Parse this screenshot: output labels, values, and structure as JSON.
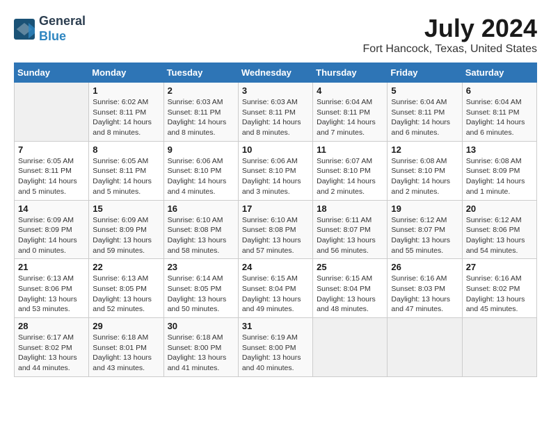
{
  "header": {
    "logo_line1": "General",
    "logo_line2": "Blue",
    "title": "July 2024",
    "subtitle": "Fort Hancock, Texas, United States"
  },
  "calendar": {
    "weekdays": [
      "Sunday",
      "Monday",
      "Tuesday",
      "Wednesday",
      "Thursday",
      "Friday",
      "Saturday"
    ],
    "weeks": [
      [
        {
          "day": "",
          "empty": true
        },
        {
          "day": "1",
          "sunrise": "6:02 AM",
          "sunset": "8:11 PM",
          "daylight": "14 hours and 8 minutes."
        },
        {
          "day": "2",
          "sunrise": "6:03 AM",
          "sunset": "8:11 PM",
          "daylight": "14 hours and 8 minutes."
        },
        {
          "day": "3",
          "sunrise": "6:03 AM",
          "sunset": "8:11 PM",
          "daylight": "14 hours and 8 minutes."
        },
        {
          "day": "4",
          "sunrise": "6:04 AM",
          "sunset": "8:11 PM",
          "daylight": "14 hours and 7 minutes."
        },
        {
          "day": "5",
          "sunrise": "6:04 AM",
          "sunset": "8:11 PM",
          "daylight": "14 hours and 6 minutes."
        },
        {
          "day": "6",
          "sunrise": "6:04 AM",
          "sunset": "8:11 PM",
          "daylight": "14 hours and 6 minutes."
        }
      ],
      [
        {
          "day": "7",
          "sunrise": "6:05 AM",
          "sunset": "8:11 PM",
          "daylight": "14 hours and 5 minutes."
        },
        {
          "day": "8",
          "sunrise": "6:05 AM",
          "sunset": "8:11 PM",
          "daylight": "14 hours and 5 minutes."
        },
        {
          "day": "9",
          "sunrise": "6:06 AM",
          "sunset": "8:10 PM",
          "daylight": "14 hours and 4 minutes."
        },
        {
          "day": "10",
          "sunrise": "6:06 AM",
          "sunset": "8:10 PM",
          "daylight": "14 hours and 3 minutes."
        },
        {
          "day": "11",
          "sunrise": "6:07 AM",
          "sunset": "8:10 PM",
          "daylight": "14 hours and 2 minutes."
        },
        {
          "day": "12",
          "sunrise": "6:08 AM",
          "sunset": "8:10 PM",
          "daylight": "14 hours and 2 minutes."
        },
        {
          "day": "13",
          "sunrise": "6:08 AM",
          "sunset": "8:09 PM",
          "daylight": "14 hours and 1 minute."
        }
      ],
      [
        {
          "day": "14",
          "sunrise": "6:09 AM",
          "sunset": "8:09 PM",
          "daylight": "14 hours and 0 minutes."
        },
        {
          "day": "15",
          "sunrise": "6:09 AM",
          "sunset": "8:09 PM",
          "daylight": "13 hours and 59 minutes."
        },
        {
          "day": "16",
          "sunrise": "6:10 AM",
          "sunset": "8:08 PM",
          "daylight": "13 hours and 58 minutes."
        },
        {
          "day": "17",
          "sunrise": "6:10 AM",
          "sunset": "8:08 PM",
          "daylight": "13 hours and 57 minutes."
        },
        {
          "day": "18",
          "sunrise": "6:11 AM",
          "sunset": "8:07 PM",
          "daylight": "13 hours and 56 minutes."
        },
        {
          "day": "19",
          "sunrise": "6:12 AM",
          "sunset": "8:07 PM",
          "daylight": "13 hours and 55 minutes."
        },
        {
          "day": "20",
          "sunrise": "6:12 AM",
          "sunset": "8:06 PM",
          "daylight": "13 hours and 54 minutes."
        }
      ],
      [
        {
          "day": "21",
          "sunrise": "6:13 AM",
          "sunset": "8:06 PM",
          "daylight": "13 hours and 53 minutes."
        },
        {
          "day": "22",
          "sunrise": "6:13 AM",
          "sunset": "8:05 PM",
          "daylight": "13 hours and 52 minutes."
        },
        {
          "day": "23",
          "sunrise": "6:14 AM",
          "sunset": "8:05 PM",
          "daylight": "13 hours and 50 minutes."
        },
        {
          "day": "24",
          "sunrise": "6:15 AM",
          "sunset": "8:04 PM",
          "daylight": "13 hours and 49 minutes."
        },
        {
          "day": "25",
          "sunrise": "6:15 AM",
          "sunset": "8:04 PM",
          "daylight": "13 hours and 48 minutes."
        },
        {
          "day": "26",
          "sunrise": "6:16 AM",
          "sunset": "8:03 PM",
          "daylight": "13 hours and 47 minutes."
        },
        {
          "day": "27",
          "sunrise": "6:16 AM",
          "sunset": "8:02 PM",
          "daylight": "13 hours and 45 minutes."
        }
      ],
      [
        {
          "day": "28",
          "sunrise": "6:17 AM",
          "sunset": "8:02 PM",
          "daylight": "13 hours and 44 minutes."
        },
        {
          "day": "29",
          "sunrise": "6:18 AM",
          "sunset": "8:01 PM",
          "daylight": "13 hours and 43 minutes."
        },
        {
          "day": "30",
          "sunrise": "6:18 AM",
          "sunset": "8:00 PM",
          "daylight": "13 hours and 41 minutes."
        },
        {
          "day": "31",
          "sunrise": "6:19 AM",
          "sunset": "8:00 PM",
          "daylight": "13 hours and 40 minutes."
        },
        {
          "day": "",
          "empty": true
        },
        {
          "day": "",
          "empty": true
        },
        {
          "day": "",
          "empty": true
        }
      ]
    ]
  }
}
